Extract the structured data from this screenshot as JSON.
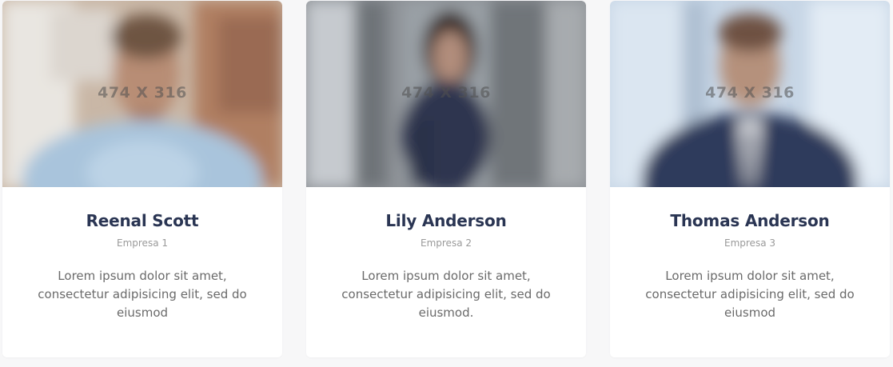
{
  "team": [
    {
      "name": "Reenal Scott",
      "company": "Empresa 1",
      "bio": "Lorem ipsum dolor sit amet, consectetur adipisicing elit, sed do eiusmod",
      "photo_label": "474 X 316"
    },
    {
      "name": "Lily Anderson",
      "company": "Empresa 2",
      "bio": "Lorem ipsum dolor sit amet, consectetur adipisicing elit, sed do eiusmod.",
      "photo_label": "474 X 316"
    },
    {
      "name": "Thomas Anderson",
      "company": "Empresa 3",
      "bio": "Lorem ipsum dolor sit amet, consectetur adipisicing elit, sed do eiusmod",
      "photo_label": "474 X 316"
    }
  ],
  "colors": {
    "page_background": "#f7f7f8",
    "card_background": "#ffffff",
    "name": "#2a3553",
    "company": "#9a9a9a",
    "bio": "#6a6a6a"
  }
}
